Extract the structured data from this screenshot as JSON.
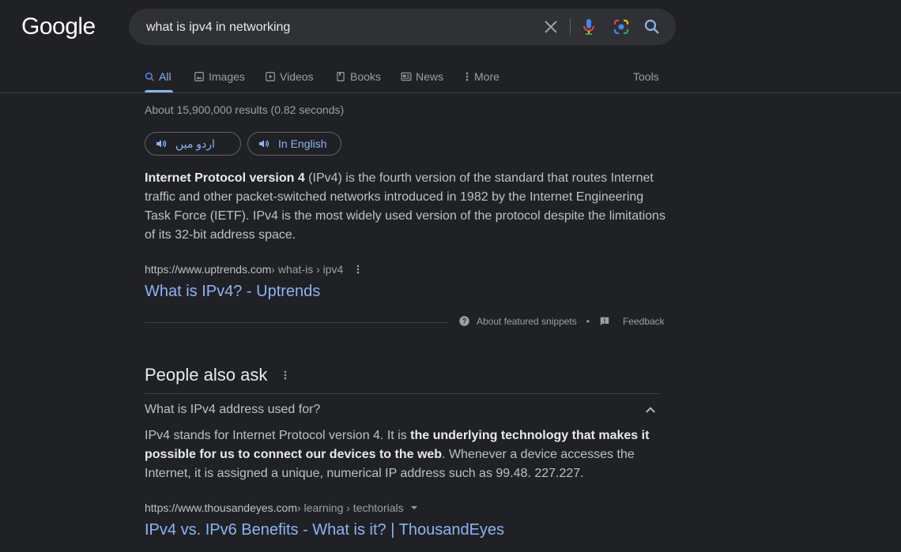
{
  "logo": "Google",
  "search": {
    "query": "what is ipv4 in networking"
  },
  "tabs": [
    {
      "label": "All",
      "icon": "search-icon"
    },
    {
      "label": "Images",
      "icon": "image-icon"
    },
    {
      "label": "Videos",
      "icon": "play-icon"
    },
    {
      "label": "Books",
      "icon": "book-icon"
    },
    {
      "label": "News",
      "icon": "news-icon"
    },
    {
      "label": "More",
      "icon": "more-vert-icon"
    }
  ],
  "tools_label": "Tools",
  "stats": "About 15,900,000 results (0.82 seconds)",
  "pills": {
    "urdu": "اردو میں",
    "english": "In English"
  },
  "snippet": {
    "bold": "Internet Protocol version 4",
    "text": " (IPv4) is the fourth version of the standard that routes Internet traffic and other packet-switched networks introduced in 1982 by the Internet Engineering Task Force (IETF). IPv4 is the most widely used version of the protocol despite the limitations of its 32-bit address space."
  },
  "result1": {
    "domain": "https://www.uptrends.com",
    "path": " › what-is › ipv4",
    "title": "What is IPv4? - Uptrends"
  },
  "fs_footer": {
    "about": "About featured snippets",
    "bullet": "•",
    "feedback": "Feedback"
  },
  "paa": {
    "heading": "People also ask",
    "question": "What is IPv4 address used for?",
    "answer_pre": "IPv4 stands for Internet Protocol version 4. It is ",
    "answer_bold": "the underlying technology that makes it possible for us to connect our devices to the web",
    "answer_post": ". Whenever a device accesses the Internet, it is assigned a unique, numerical IP address such as 99.48. 227.227."
  },
  "result2": {
    "domain": "https://www.thousandeyes.com",
    "path": " › learning › techtorials",
    "title": "IPv4 vs. IPv6 Benefits - What is it? | ThousandEyes"
  }
}
